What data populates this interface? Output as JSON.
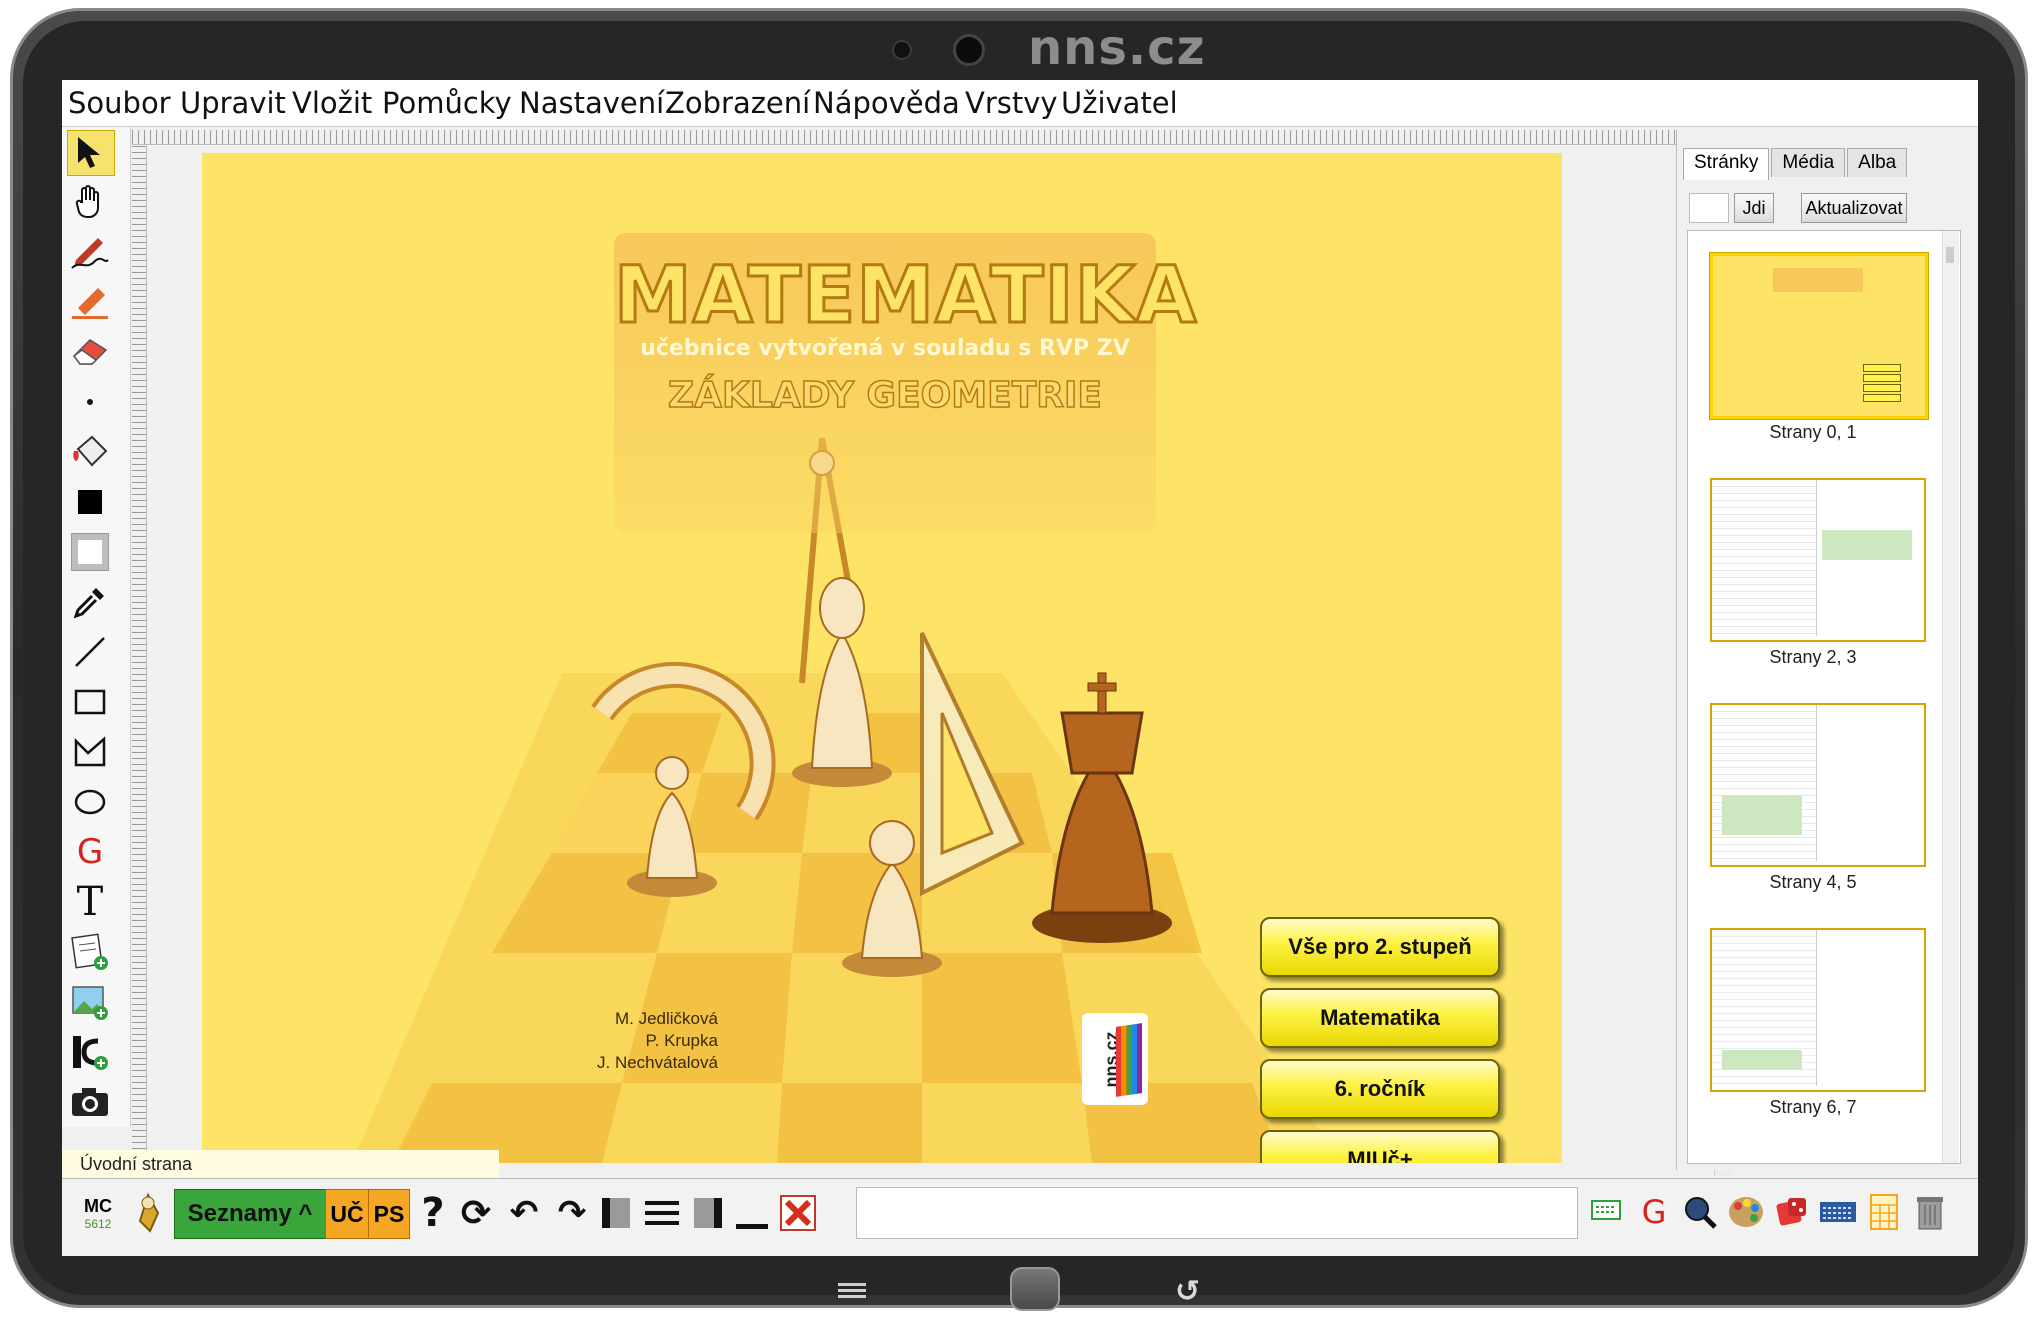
{
  "device": {
    "brand": "nns.cz"
  },
  "menu": [
    "Soubor",
    "Upravit",
    "Vložit",
    "Pomůcky",
    "Nastavení",
    "Zobrazení",
    "Nápověda",
    "Vrstvy",
    "Uživatel"
  ],
  "toolbar": {
    "tools": [
      "pointer-icon",
      "hand-icon",
      "pen-icon",
      "highlighter-icon",
      "eraser-icon",
      "dot-size-icon",
      "fill-bucket-icon",
      "fill-color-icon",
      "line-color-icon",
      "eyedropper-icon",
      "line-icon",
      "rectangle-icon",
      "polygon-icon",
      "ellipse-icon",
      "geogebra-icon",
      "text-icon",
      "add-page-icon",
      "insert-image-icon",
      "insert-media-icon",
      "camera-icon"
    ]
  },
  "cover": {
    "title": "MATEMATIKA",
    "subtitle": "učebnice vytvořená v souladu s RVP ZV",
    "topic": "ZÁKLADY GEOMETRIE",
    "authors": [
      "M. Jedličková",
      "P. Krupka",
      "J. Nechvátalová"
    ],
    "logo": "nns.cz",
    "buttons": [
      "Vše pro 2. stupeň",
      "Matematika",
      "6. ročník",
      "MIUč+"
    ]
  },
  "status": {
    "page_name": "Úvodní strana"
  },
  "right_panel": {
    "tabs": [
      "Stránky",
      "Média",
      "Alba"
    ],
    "active_tab": "Stránky",
    "goto_value": "",
    "goto_button": "Jdi",
    "refresh_button": "Aktualizovat",
    "thumbnails": [
      "Strany 0, 1",
      "Strany 2, 3",
      "Strany 4, 5",
      "Strany 6, 7"
    ]
  },
  "bottombar": {
    "mc_label": "MC",
    "mc_number": "5612",
    "seznamy": "Seznamy ^",
    "uc": "UČ",
    "ps": "PS",
    "command_value": "",
    "right_icons": [
      "keyboard-green-icon",
      "geogebra-icon",
      "search-globe-icon",
      "palette-icon",
      "dice-icon",
      "keyboard-icon",
      "calculator-icon",
      "trash-icon"
    ]
  },
  "colors": {
    "canvas": "#fde466",
    "accent": "#f6e36f",
    "seznamy": "#3aa53a",
    "uc_ps": "#f5a623"
  }
}
